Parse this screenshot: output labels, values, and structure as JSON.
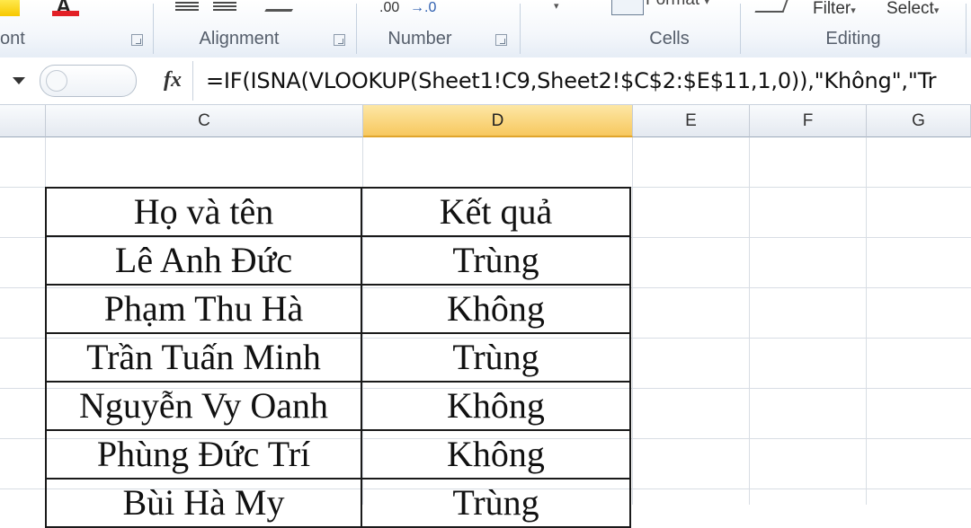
{
  "ribbon": {
    "font_partial": "ont",
    "alignment_label": "Alignment",
    "number_label": "Number",
    "number_decimal_text": ".00",
    "number_arrow_text": "→.0",
    "cells_label": "Cells",
    "format_partial": "Format",
    "editing_label": "Editing",
    "filter_partial": "Filter",
    "select_partial": "Select"
  },
  "formula_bar": {
    "fx_label": "fx",
    "formula": "=IF(ISNA(VLOOKUP(Sheet1!C9,Sheet2!$C$2:$E$11,1,0)),\"Không\",\"Tr"
  },
  "columns": [
    "C",
    "D",
    "E",
    "F",
    "G"
  ],
  "selected_column": "D",
  "table": {
    "headers": [
      "Họ và tên",
      "Kết quả"
    ],
    "rows": [
      [
        "Lê Anh Đức",
        "Trùng"
      ],
      [
        "Phạm Thu Hà",
        "Không"
      ],
      [
        "Trần Tuấn Minh",
        "Trùng"
      ],
      [
        "Nguyễn Vy Oanh",
        "Không"
      ],
      [
        "Phùng Đức Trí",
        "Không"
      ],
      [
        "Bùi Hà My",
        "Trùng"
      ]
    ]
  },
  "colors": {
    "selected_header": "#f7c85f",
    "font_color_bar": "#e21f26",
    "gridline": "#d8dde4"
  }
}
